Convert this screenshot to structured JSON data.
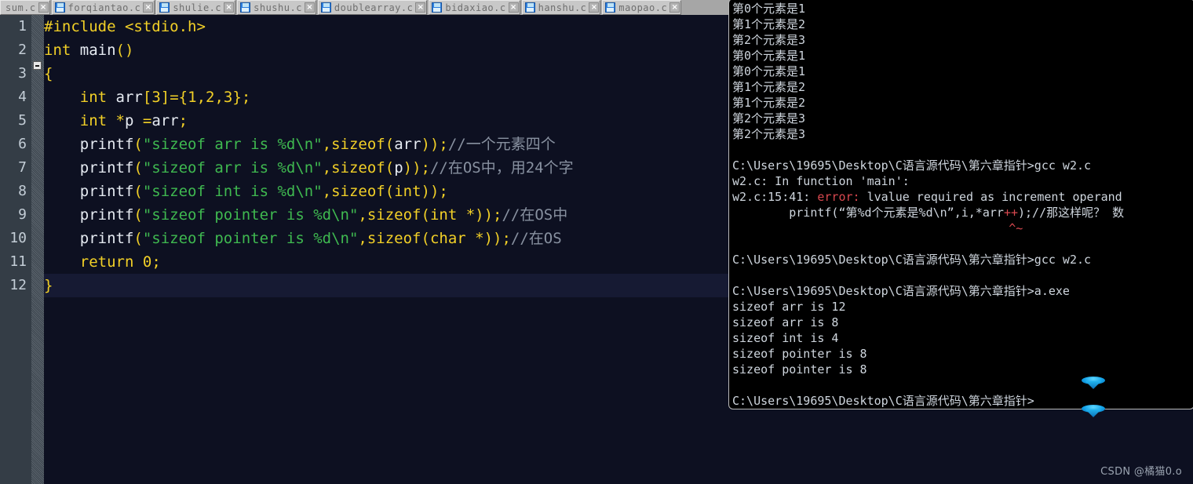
{
  "window": {
    "editor_bg": "#0d1021",
    "gutter_bg": "#343d46",
    "tabbar_bg": "#a6a6a6",
    "terminal_bg": "#000000"
  },
  "tabbar": {
    "tabs": [
      {
        "label": "sum.c",
        "icon": "file-save-icon",
        "has_icon": false,
        "close": "×"
      },
      {
        "label": "forqiantao.c",
        "icon": "file-save-icon",
        "has_icon": true,
        "close": "×"
      },
      {
        "label": "shulie.c",
        "icon": "file-save-icon",
        "has_icon": true,
        "close": "×"
      },
      {
        "label": "shushu.c",
        "icon": "file-save-icon",
        "has_icon": true,
        "close": "×"
      },
      {
        "label": "doublearray.c",
        "icon": "file-save-icon",
        "has_icon": true,
        "close": "×"
      },
      {
        "label": "bidaxiao.c",
        "icon": "file-save-icon",
        "has_icon": true,
        "close": "×"
      },
      {
        "label": "hanshu.c",
        "icon": "file-save-icon",
        "has_icon": true,
        "close": "×"
      },
      {
        "label": "maopao.c",
        "icon": "file-save-icon",
        "has_icon": true,
        "close": "×"
      }
    ]
  },
  "editor": {
    "line_numbers": [
      "1",
      "2",
      "3",
      "4",
      "5",
      "6",
      "7",
      "8",
      "9",
      "10",
      "11",
      "12"
    ],
    "fold_marker": "collapse-marker",
    "current_line": 12,
    "lines": [
      {
        "n": "1",
        "tokens": [
          {
            "t": "#include ",
            "c": "kw"
          },
          {
            "t": "<stdio.h>",
            "c": "kw"
          }
        ]
      },
      {
        "n": "2",
        "tokens": [
          {
            "t": "int",
            "c": "kw"
          },
          {
            "t": " ",
            "c": "plain"
          },
          {
            "t": "main",
            "c": "white"
          },
          {
            "t": "()",
            "c": "punc"
          }
        ]
      },
      {
        "n": "3",
        "tokens": [
          {
            "t": "{",
            "c": "punc"
          }
        ]
      },
      {
        "n": "4",
        "tokens": [
          {
            "t": "    ",
            "c": "plain"
          },
          {
            "t": "int",
            "c": "kw"
          },
          {
            "t": " ",
            "c": "plain"
          },
          {
            "t": "arr",
            "c": "white"
          },
          {
            "t": "[",
            "c": "punc"
          },
          {
            "t": "3",
            "c": "num"
          },
          {
            "t": "]={",
            "c": "punc"
          },
          {
            "t": "1",
            "c": "num"
          },
          {
            "t": ",",
            "c": "punc"
          },
          {
            "t": "2",
            "c": "num"
          },
          {
            "t": ",",
            "c": "punc"
          },
          {
            "t": "3",
            "c": "num"
          },
          {
            "t": "};",
            "c": "punc"
          }
        ]
      },
      {
        "n": "5",
        "tokens": [
          {
            "t": "    ",
            "c": "plain"
          },
          {
            "t": "int",
            "c": "kw"
          },
          {
            "t": " ",
            "c": "plain"
          },
          {
            "t": "*",
            "c": "punc"
          },
          {
            "t": "p ",
            "c": "white"
          },
          {
            "t": "=",
            "c": "punc"
          },
          {
            "t": "arr",
            "c": "white"
          },
          {
            "t": ";",
            "c": "punc"
          }
        ]
      },
      {
        "n": "6",
        "tokens": [
          {
            "t": "    ",
            "c": "plain"
          },
          {
            "t": "printf",
            "c": "white"
          },
          {
            "t": "(",
            "c": "punc"
          },
          {
            "t": "\"sizeof arr is %d\\n\"",
            "c": "str"
          },
          {
            "t": ",",
            "c": "punc"
          },
          {
            "t": "sizeof",
            "c": "kw"
          },
          {
            "t": "(",
            "c": "punc"
          },
          {
            "t": "arr",
            "c": "white"
          },
          {
            "t": "));",
            "c": "punc"
          },
          {
            "t": "//一个元素四个",
            "c": "cmt"
          }
        ]
      },
      {
        "n": "7",
        "tokens": [
          {
            "t": "    ",
            "c": "plain"
          },
          {
            "t": "printf",
            "c": "white"
          },
          {
            "t": "(",
            "c": "punc"
          },
          {
            "t": "\"sizeof arr is %d\\n\"",
            "c": "str"
          },
          {
            "t": ",",
            "c": "punc"
          },
          {
            "t": "sizeof",
            "c": "kw"
          },
          {
            "t": "(",
            "c": "punc"
          },
          {
            "t": "p",
            "c": "white"
          },
          {
            "t": "));",
            "c": "punc"
          },
          {
            "t": "//在OS中，用24个字",
            "c": "cmt"
          }
        ]
      },
      {
        "n": "8",
        "tokens": [
          {
            "t": "    ",
            "c": "plain"
          },
          {
            "t": "printf",
            "c": "white"
          },
          {
            "t": "(",
            "c": "punc"
          },
          {
            "t": "\"sizeof int is %d\\n\"",
            "c": "str"
          },
          {
            "t": ",",
            "c": "punc"
          },
          {
            "t": "sizeof",
            "c": "kw"
          },
          {
            "t": "(",
            "c": "punc"
          },
          {
            "t": "int",
            "c": "kw"
          },
          {
            "t": "));",
            "c": "punc"
          }
        ]
      },
      {
        "n": "9",
        "tokens": [
          {
            "t": "    ",
            "c": "plain"
          },
          {
            "t": "printf",
            "c": "white"
          },
          {
            "t": "(",
            "c": "punc"
          },
          {
            "t": "\"sizeof pointer is %d\\n\"",
            "c": "str"
          },
          {
            "t": ",",
            "c": "punc"
          },
          {
            "t": "sizeof",
            "c": "kw"
          },
          {
            "t": "(",
            "c": "punc"
          },
          {
            "t": "int",
            "c": "kw"
          },
          {
            "t": " *));",
            "c": "punc"
          },
          {
            "t": "//在OS中",
            "c": "cmt"
          }
        ]
      },
      {
        "n": "10",
        "tokens": [
          {
            "t": "    ",
            "c": "plain"
          },
          {
            "t": "printf",
            "c": "white"
          },
          {
            "t": "(",
            "c": "punc"
          },
          {
            "t": "\"sizeof pointer is %d\\n\"",
            "c": "str"
          },
          {
            "t": ",",
            "c": "punc"
          },
          {
            "t": "sizeof",
            "c": "kw"
          },
          {
            "t": "(",
            "c": "punc"
          },
          {
            "t": "char",
            "c": "kw"
          },
          {
            "t": " *));",
            "c": "punc"
          },
          {
            "t": "//在OS",
            "c": "cmt"
          }
        ]
      },
      {
        "n": "11",
        "tokens": [
          {
            "t": "    ",
            "c": "plain"
          },
          {
            "t": "return",
            "c": "kw"
          },
          {
            "t": " ",
            "c": "plain"
          },
          {
            "t": "0",
            "c": "num"
          },
          {
            "t": ";",
            "c": "punc"
          }
        ]
      },
      {
        "n": "12",
        "tokens": [
          {
            "t": "}",
            "c": "punc"
          }
        ]
      }
    ]
  },
  "terminal": {
    "lines": [
      {
        "text": "第0个元素是1"
      },
      {
        "text": "第1个元素是2"
      },
      {
        "text": "第2个元素是3"
      },
      {
        "text": "第0个元素是1"
      },
      {
        "text": "第0个元素是1"
      },
      {
        "text": "第1个元素是2"
      },
      {
        "text": "第1个元素是2"
      },
      {
        "text": "第2个元素是3"
      },
      {
        "text": "第2个元素是3"
      },
      {
        "text": ""
      },
      {
        "text": "C:\\Users\\19695\\Desktop\\C语言源代码\\第六章指针>gcc w2.c"
      },
      {
        "text": "w2.c: In function 'main':"
      },
      {
        "segments": [
          {
            "t": "w2.c:15:41: ",
            "c": ""
          },
          {
            "t": "error:",
            "c": "err"
          },
          {
            "t": " lvalue required as increment operand",
            "c": ""
          }
        ]
      },
      {
        "segments": [
          {
            "t": "        printf(“第%d个元素是%d\\n”,i,*arr",
            "c": ""
          },
          {
            "t": "++",
            "c": "err"
          },
          {
            "t": ");//那这样呢？ 数",
            "c": ""
          }
        ]
      },
      {
        "segments": [
          {
            "t": "                                       ",
            "c": ""
          },
          {
            "t": "^~",
            "c": "caret"
          }
        ]
      },
      {
        "text": ""
      },
      {
        "text": "C:\\Users\\19695\\Desktop\\C语言源代码\\第六章指针>gcc w2.c"
      },
      {
        "text": ""
      },
      {
        "text": "C:\\Users\\19695\\Desktop\\C语言源代码\\第六章指针>a.exe"
      },
      {
        "text": "sizeof arr is 12"
      },
      {
        "text": "sizeof arr is 8"
      },
      {
        "text": "sizeof int is 4"
      },
      {
        "text": "sizeof pointer is 8"
      },
      {
        "text": "sizeof pointer is 8"
      },
      {
        "text": ""
      },
      {
        "text": "C:\\Users\\19695\\Desktop\\C语言源代码\\第六章指针>"
      }
    ]
  },
  "watermark": {
    "text": "CSDN @橘猫0.o"
  }
}
